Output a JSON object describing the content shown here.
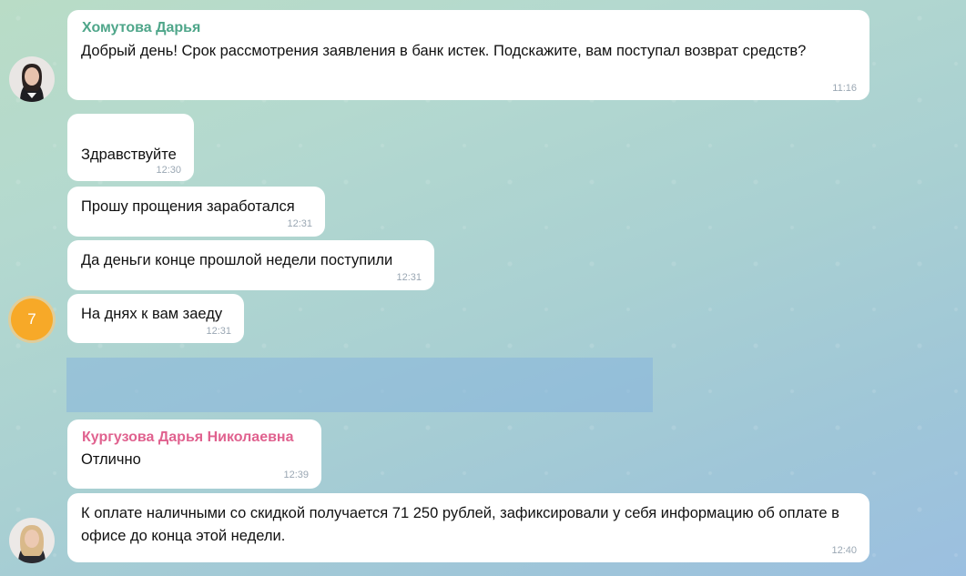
{
  "messages": [
    {
      "sender": "Хомутова Дарья",
      "text": "Добрый день! Срок рассмотрения заявления в банк истек. Подскажите, вам поступал возврат средств?",
      "time": "11:16"
    },
    {
      "text": "Здравствуйте",
      "time": "12:30"
    },
    {
      "text": "Прошу прощения заработался",
      "time": "12:31"
    },
    {
      "text": "Да деньги конце прошлой недели поступили",
      "time": "12:31"
    },
    {
      "text": "На днях к вам заеду",
      "time": "12:31"
    },
    {
      "sender": "Кургузова Дарья Николаевна",
      "text": "Отлично",
      "time": "12:39"
    },
    {
      "text": "К оплате наличными со скидкой получается 71 250 рублей, зафиксировали у себя информацию об оплате в офисе до конца этой недели.",
      "time": "12:40"
    }
  ],
  "avatar_initial": "7",
  "colors": {
    "sender_green": "#4fa68a",
    "sender_pink": "#e0628f",
    "time_gray": "#9aa7b3",
    "avatar_orange": "#f7a928"
  }
}
